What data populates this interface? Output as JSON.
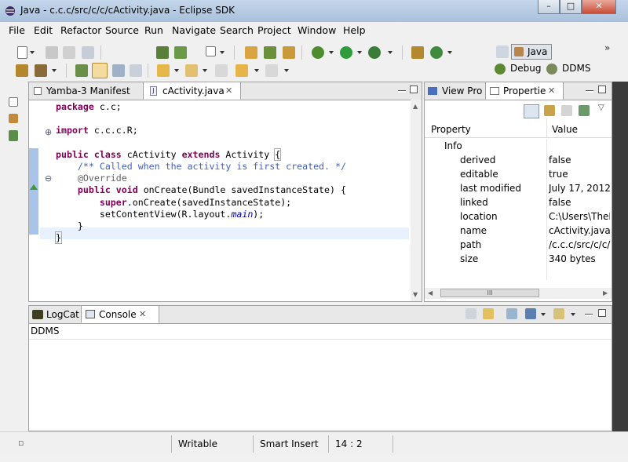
{
  "window": {
    "title": "Java - c.c.c/src/c/c/cActivity.java - Eclipse SDK"
  },
  "menu": [
    "File",
    "Edit",
    "Refactor",
    "Source",
    "Run",
    "Navigate",
    "Search",
    "Project",
    "Window",
    "Help"
  ],
  "perspectives": {
    "java": "Java",
    "debug": "Debug",
    "ddms": "DDMS"
  },
  "editor": {
    "tabs": [
      {
        "label": "Yamba-3 Manifest"
      },
      {
        "label": "cActivity.java"
      }
    ],
    "code": {
      "l1_kw": "package",
      "l1_rest": " c.c;",
      "l2_kw": "import",
      "l2_rest": " c.c.c.R;",
      "l3_kw1": "public",
      "l3_kw2": "class",
      "l3_name": " cActivity ",
      "l3_kw3": "extends",
      "l3_rest": " Activity ",
      "l3_brace": "{",
      "l4_comment": "/** Called when the activity is first created. */",
      "l5_annotation": "@Override",
      "l6_kw1": "public",
      "l6_kw2": "void",
      "l6_rest": " onCreate(Bundle savedInstanceState) {",
      "l7_kw": "super",
      "l7_rest": ".onCreate(savedInstanceState);",
      "l8_pre": "setContentView(R.layout.",
      "l8_field": "main",
      "l8_post": ");",
      "l9": "}",
      "l10": "}"
    }
  },
  "properties": {
    "tabs": [
      {
        "label": "View Pro"
      },
      {
        "label": "Propertie"
      }
    ],
    "headers": {
      "property": "Property",
      "value": "Value"
    },
    "group": "Info",
    "rows": [
      {
        "name": "derived",
        "value": "false"
      },
      {
        "name": "editable",
        "value": "true"
      },
      {
        "name": "last modified",
        "value": "July 17, 2012 12:"
      },
      {
        "name": "linked",
        "value": "false"
      },
      {
        "name": "location",
        "value": "C:\\Users\\TheR"
      },
      {
        "name": "name",
        "value": "cActivity.java"
      },
      {
        "name": "path",
        "value": "/c.c.c/src/c/c/"
      },
      {
        "name": "size",
        "value": "340  bytes"
      }
    ],
    "scroll_thumb": "III"
  },
  "console": {
    "tabs": [
      {
        "label": "LogCat"
      },
      {
        "label": "Console"
      }
    ],
    "heading": "DDMS"
  },
  "status": {
    "writable": "Writable",
    "insert": "Smart Insert",
    "position": "14 : 2"
  },
  "colors": {
    "keyword": "#7f0055",
    "comment": "#3f5fbf",
    "annotation": "#646464",
    "field": "#0000c0",
    "titlebar": "#b9cde4"
  }
}
